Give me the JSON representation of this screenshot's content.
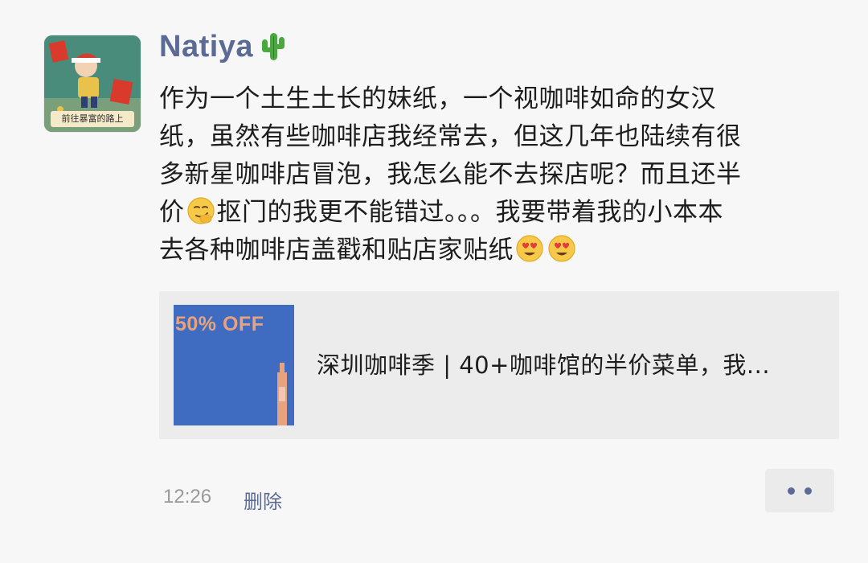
{
  "post": {
    "nickname": "Natiya",
    "nickname_emoji": "cactus-icon",
    "avatar_caption": "前往暴富的路上",
    "content_lines": [
      "作为一个土生土长的妹纸，一个视咖啡如命的女汉",
      "纸，虽然有些咖啡店我经常去，但这几年也陆续有很",
      "多新星咖啡店冒泡，我怎么能不去探店呢？而且还半",
      {
        "before": "价",
        "emoji": "smirk-face-icon",
        "after": "抠门的我更不能错过。。。我要带着我的小本本"
      },
      {
        "text": "去各种咖啡店盖戳和贴店家贴纸",
        "emojis": [
          "heart-eyes-face-icon",
          "heart-eyes-face-icon"
        ]
      }
    ],
    "link_card": {
      "thumbnail_text": "50% OFF",
      "title": "深圳咖啡季 | 40+咖啡馆的半价菜单，我..."
    },
    "time": "12:26",
    "delete_label": "删除",
    "more_icon": "more-dots-icon"
  },
  "colors": {
    "background": "#f7f7f7",
    "nickname": "#5b6b96",
    "link": "#5b6b96",
    "card_background": "#ececec",
    "thumbnail_blue": "#3f6cc0",
    "thumbnail_text": "#e8a27e",
    "timestamp": "#9a9a9a"
  }
}
